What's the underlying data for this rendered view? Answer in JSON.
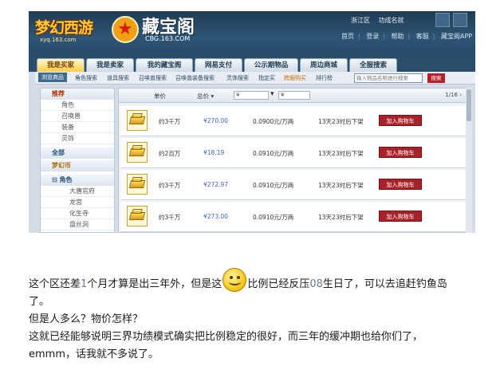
{
  "site": {
    "game_logo": "梦幻西游",
    "game_url": "xyq.163.com",
    "title": "藏宝阁",
    "domain": "CBG.163.COM",
    "server": "浙江区",
    "server_name": "功成名就"
  },
  "header_nav": [
    "首页",
    "登录",
    "帮助",
    "客服",
    "藏宝阁APP"
  ],
  "tabs": [
    "我是买家",
    "我是卖家",
    "我的藏宝阁",
    "网易支付",
    "公示期物品",
    "周边商城",
    "全服搜索"
  ],
  "sub_nav": [
    "浏览商品",
    "角色搜索",
    "道具搜索",
    "召唤兽搜索",
    "召唤兽装备搜索",
    "灵饰搜索",
    "指定买",
    "跨服购买",
    "排行榜"
  ],
  "search": {
    "placeholder": "输入物品名称进行搜索",
    "button": "搜索"
  },
  "sidebar": {
    "recommend": "推荐",
    "recommend_items": [
      "角色",
      "召唤兽",
      "装备",
      "灵饰"
    ],
    "all": "全部",
    "currency": "梦幻币",
    "role": "角色",
    "role_items": [
      "大唐官府",
      "龙宫",
      "化生寺",
      "盘丝洞"
    ]
  },
  "list_header": {
    "unit_price": "单价",
    "total_price": "总价",
    "currency_symbol": "¥",
    "pager": "1/16"
  },
  "listings": [
    {
      "amount": "约3千万",
      "price": "¥270.00",
      "rate": "0.0900元/万两",
      "time": "13天23时后下架",
      "button": "加入购物车"
    },
    {
      "amount": "约2百万",
      "price": "¥18.19",
      "rate": "0.0910元/万两",
      "time": "13天23时后下架",
      "button": "加入购物车"
    },
    {
      "amount": "约3千万",
      "price": "¥272.97",
      "rate": "0.0910元/万两",
      "time": "13天23时后下架",
      "button": "加入购物车"
    },
    {
      "amount": "约3千万",
      "price": "¥273.00",
      "rate": "0.0910元/万两",
      "time": "13天23时后下架",
      "button": "加入购物车"
    }
  ],
  "post": {
    "p1a": "这个区还差",
    "p1n": "1",
    "p1b": "个月才算是出三年外，但是这",
    "p1c": "比例已经反压",
    "p1d": "08",
    "p1e": "生日了，可以去追赶钓鱼岛",
    "p1f": "了。",
    "p2": "但是人多么？物价怎样？",
    "p3": "这就已经能够说明三界功绩模式确实把比例稳定的很好，而三年的缓冲期也给你们了，",
    "p4": "emmm，话我就不多说了。"
  },
  "colors": {
    "header": "#2e5575",
    "accent": "#a8222a",
    "price": "#3c5fd6",
    "tab_active": "#ffcd48"
  }
}
